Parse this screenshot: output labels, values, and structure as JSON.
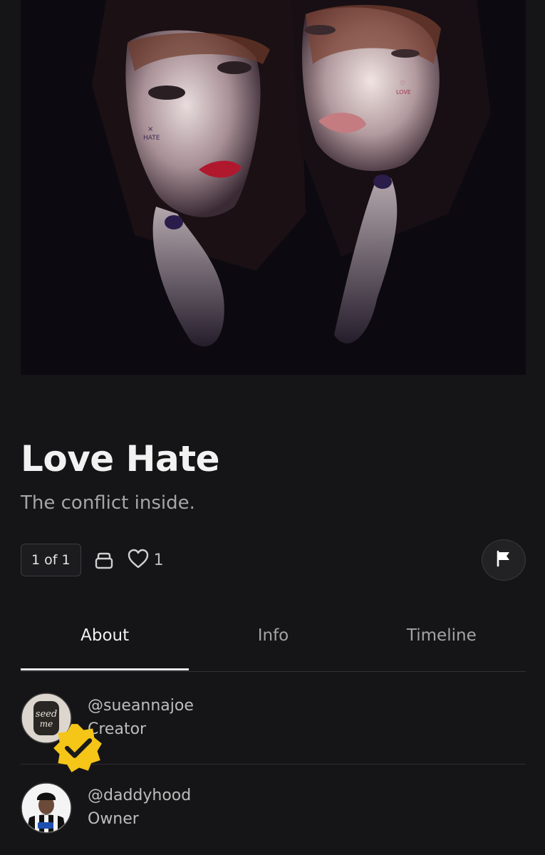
{
  "artwork": {
    "alt_marks": [
      "HATE",
      "LOVE"
    ]
  },
  "title": "Love Hate",
  "description": "The conflict inside.",
  "edition": "1 of 1",
  "likes": "1",
  "icons": {
    "edition": "stack-icon",
    "like": "heart-icon",
    "report": "flag-icon"
  },
  "tabs": [
    {
      "label": "About",
      "active": true
    },
    {
      "label": "Info",
      "active": false
    },
    {
      "label": "Timeline",
      "active": false
    }
  ],
  "people": [
    {
      "handle": "@sueannajoe",
      "role": "Creator",
      "verified": true
    },
    {
      "handle": "@daddyhood",
      "role": "Owner",
      "verified": false
    }
  ],
  "colors": {
    "background": "#151517",
    "text": "#efefef",
    "muted": "#a6a6a8",
    "verified": "#f5c518"
  }
}
